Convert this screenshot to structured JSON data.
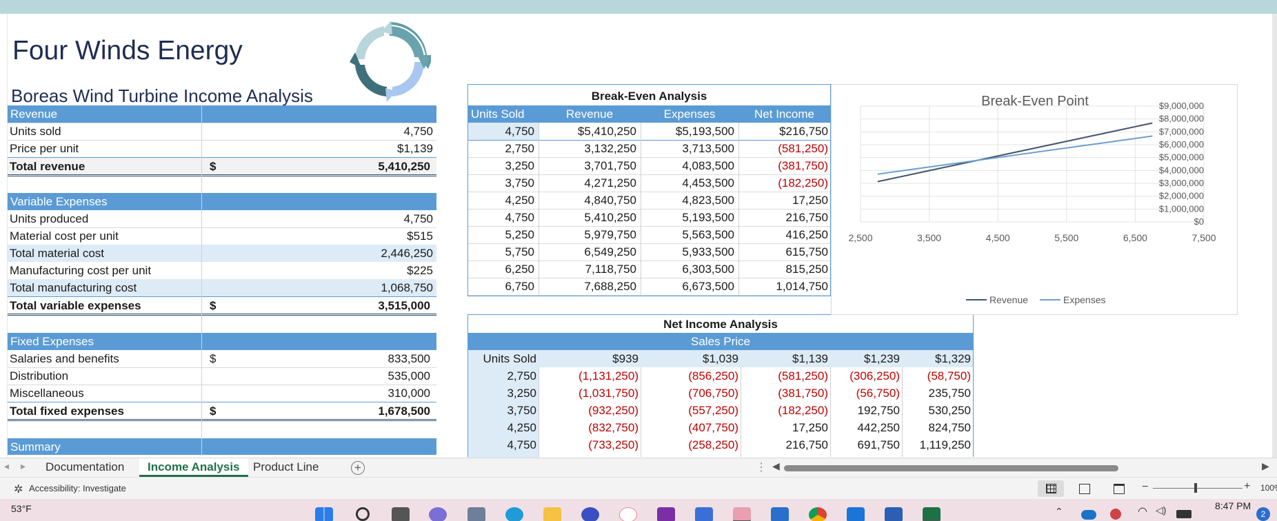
{
  "company": "Four Winds Energy",
  "subtitle": "Boreas Wind Turbine Income Analysis",
  "income": {
    "revenue_header": "Revenue",
    "units_sold_label": "Units sold",
    "units_sold": "4,750",
    "price_label": "Price per unit",
    "price": "$1,139",
    "total_revenue_label": "Total revenue",
    "total_revenue_dollar": "$",
    "total_revenue": "5,410,250",
    "var_header": "Variable Expenses",
    "units_produced_label": "Units produced",
    "units_produced": "4,750",
    "material_cost_label": "Material cost per unit",
    "material_cost": "$515",
    "total_material_label": "Total material cost",
    "total_material": "2,446,250",
    "mfg_cost_label": "Manufacturing cost per unit",
    "mfg_cost": "$225",
    "total_mfg_label": "Total manufacturing cost",
    "total_mfg": "1,068,750",
    "total_var_label": "Total variable expenses",
    "total_var_dollar": "$",
    "total_var": "3,515,000",
    "fixed_header": "Fixed Expenses",
    "salaries_label": "Salaries and benefits",
    "salaries_dollar": "$",
    "salaries": "833,500",
    "distribution_label": "Distribution",
    "distribution": "535,000",
    "misc_label": "Miscellaneous",
    "misc": "310,000",
    "total_fixed_label": "Total fixed expenses",
    "total_fixed_dollar": "$",
    "total_fixed": "1,678,500",
    "summary_header": "Summary"
  },
  "breakeven": {
    "title": "Break-Even Analysis",
    "headers": [
      "Units Sold",
      "Revenue",
      "Expenses",
      "Net Income"
    ],
    "rows": [
      [
        "4,750",
        "$5,410,250",
        "$5,193,500",
        "$216,750"
      ],
      [
        "2,750",
        "3,132,250",
        "3,713,500",
        "(581,250)"
      ],
      [
        "3,250",
        "3,701,750",
        "4,083,500",
        "(381,750)"
      ],
      [
        "3,750",
        "4,271,250",
        "4,453,500",
        "(182,250)"
      ],
      [
        "4,250",
        "4,840,750",
        "4,823,500",
        "17,250"
      ],
      [
        "4,750",
        "5,410,250",
        "5,193,500",
        "216,750"
      ],
      [
        "5,250",
        "5,979,750",
        "5,563,500",
        "416,250"
      ],
      [
        "5,750",
        "6,549,250",
        "5,933,500",
        "615,750"
      ],
      [
        "6,250",
        "7,118,750",
        "6,303,500",
        "815,250"
      ],
      [
        "6,750",
        "7,688,250",
        "6,673,500",
        "1,014,750"
      ]
    ]
  },
  "netincome": {
    "title": "Net Income Analysis",
    "sales_price_label": "Sales Price",
    "units_label": "Units Sold",
    "prices": [
      "$939",
      "$1,039",
      "$1,139",
      "$1,239",
      "$1,329"
    ],
    "rows": [
      [
        "2,750",
        "(1,131,250)",
        "(856,250)",
        "(581,250)",
        "(306,250)",
        "(58,750)"
      ],
      [
        "3,250",
        "(1,031,750)",
        "(706,750)",
        "(381,750)",
        "(56,750)",
        "235,750"
      ],
      [
        "3,750",
        "(932,250)",
        "(557,250)",
        "(182,250)",
        "192,750",
        "530,250"
      ],
      [
        "4,250",
        "(832,750)",
        "(407,750)",
        "17,250",
        "442,250",
        "824,750"
      ],
      [
        "4,750",
        "(733,250)",
        "(258,250)",
        "216,750",
        "691,750",
        "1,119,250"
      ]
    ]
  },
  "chart_data": {
    "type": "line",
    "title": "Break-Even Point",
    "xlabel": "",
    "ylabel": "",
    "x_ticks": [
      "2,500",
      "3,500",
      "4,500",
      "5,500",
      "6,500",
      "7,500"
    ],
    "y_ticks": [
      "$0",
      "$1,000,000",
      "$2,000,000",
      "$3,000,000",
      "$4,000,000",
      "$5,000,000",
      "$6,000,000",
      "$7,000,000",
      "$8,000,000",
      "$9,000,000"
    ],
    "xlim": [
      2500,
      7500
    ],
    "ylim": [
      0,
      9000000
    ],
    "legend_position": "bottom",
    "grid": true,
    "series": [
      {
        "name": "Revenue",
        "color": "#44546a",
        "x": [
          2750,
          3250,
          3750,
          4250,
          4750,
          5250,
          5750,
          6250,
          6750
        ],
        "values": [
          3132250,
          3701750,
          4271250,
          4840750,
          5410250,
          5979750,
          6549250,
          7118750,
          7688250
        ]
      },
      {
        "name": "Expenses",
        "color": "#6a9fcf",
        "x": [
          2750,
          3250,
          3750,
          4250,
          4750,
          5250,
          5750,
          6250,
          6750
        ],
        "values": [
          3713500,
          4083500,
          4453500,
          4823500,
          5193500,
          5563500,
          5933500,
          6303500,
          6673500
        ]
      }
    ]
  },
  "tabs": [
    "Documentation",
    "Income Analysis",
    "Product Line"
  ],
  "active_tab": "Income Analysis",
  "status": {
    "accessibility": "Accessibility: Investigate",
    "zoom": "100%"
  },
  "taskbar": {
    "weather": "53°F",
    "time": "8:47 PM",
    "notification_count": "2"
  }
}
